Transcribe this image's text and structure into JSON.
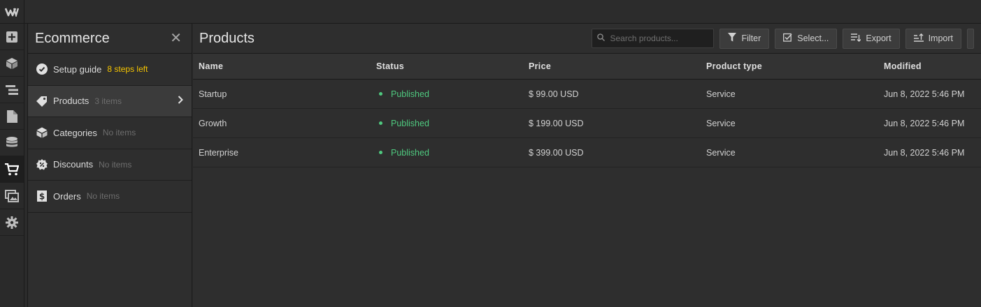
{
  "panel": {
    "title": "Ecommerce",
    "close": "✕",
    "items": [
      {
        "label": "Setup guide",
        "sub": "8 steps left",
        "icon": "check-circle-icon"
      },
      {
        "label": "Products",
        "sub": "3 items",
        "icon": "tag-icon"
      },
      {
        "label": "Categories",
        "sub": "No items",
        "icon": "box-icon"
      },
      {
        "label": "Discounts",
        "sub": "No items",
        "icon": "badge-icon"
      },
      {
        "label": "Orders",
        "sub": "No items",
        "icon": "dollar-receipt-icon"
      }
    ]
  },
  "main": {
    "title": "Products",
    "search_placeholder": "Search products...",
    "buttons": {
      "filter": "Filter",
      "select": "Select...",
      "export": "Export",
      "import": "Import"
    }
  },
  "table": {
    "headers": [
      "Name",
      "Status",
      "Price",
      "Product type",
      "Modified"
    ],
    "rows": [
      {
        "name": "Startup",
        "status": "Published",
        "price": "$ 99.00 USD",
        "type": "Service",
        "modified": "Jun 8, 2022 5:46 PM"
      },
      {
        "name": "Growth",
        "status": "Published",
        "price": "$ 199.00 USD",
        "type": "Service",
        "modified": "Jun 8, 2022 5:46 PM"
      },
      {
        "name": "Enterprise",
        "status": "Published",
        "price": "$ 399.00 USD",
        "type": "Service",
        "modified": "Jun 8, 2022 5:46 PM"
      }
    ]
  },
  "colors": {
    "accent_warn": "#f5c400",
    "status_published": "#4fc97f",
    "background": "#2e2e2e"
  }
}
